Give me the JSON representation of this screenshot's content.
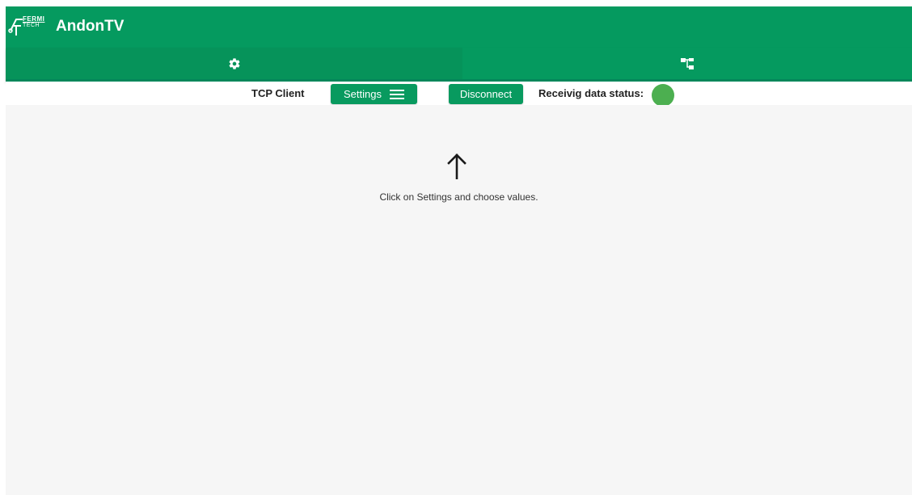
{
  "app": {
    "title": "AndonTV",
    "logo_text_top": "FERMI",
    "logo_text_bottom": "TECH",
    "logo_icon": "fermitech-logo"
  },
  "tabs": [
    {
      "icon": "gear-icon",
      "selected": true
    },
    {
      "icon": "sitemap-icon",
      "selected": false
    }
  ],
  "toolbar": {
    "mode_label": "TCP Client",
    "settings_label": "Settings",
    "settings_icon": "menu-icon",
    "disconnect_label": "Disconnect",
    "status_label": "Receivig data status:",
    "status_color": "#4caf50"
  },
  "main": {
    "hint_icon": "arrow-up-icon",
    "hint_text": "Click on Settings and choose values."
  },
  "colors": {
    "primary": "#059a5f",
    "background": "#f6f6f6",
    "status_ok": "#4caf50"
  }
}
